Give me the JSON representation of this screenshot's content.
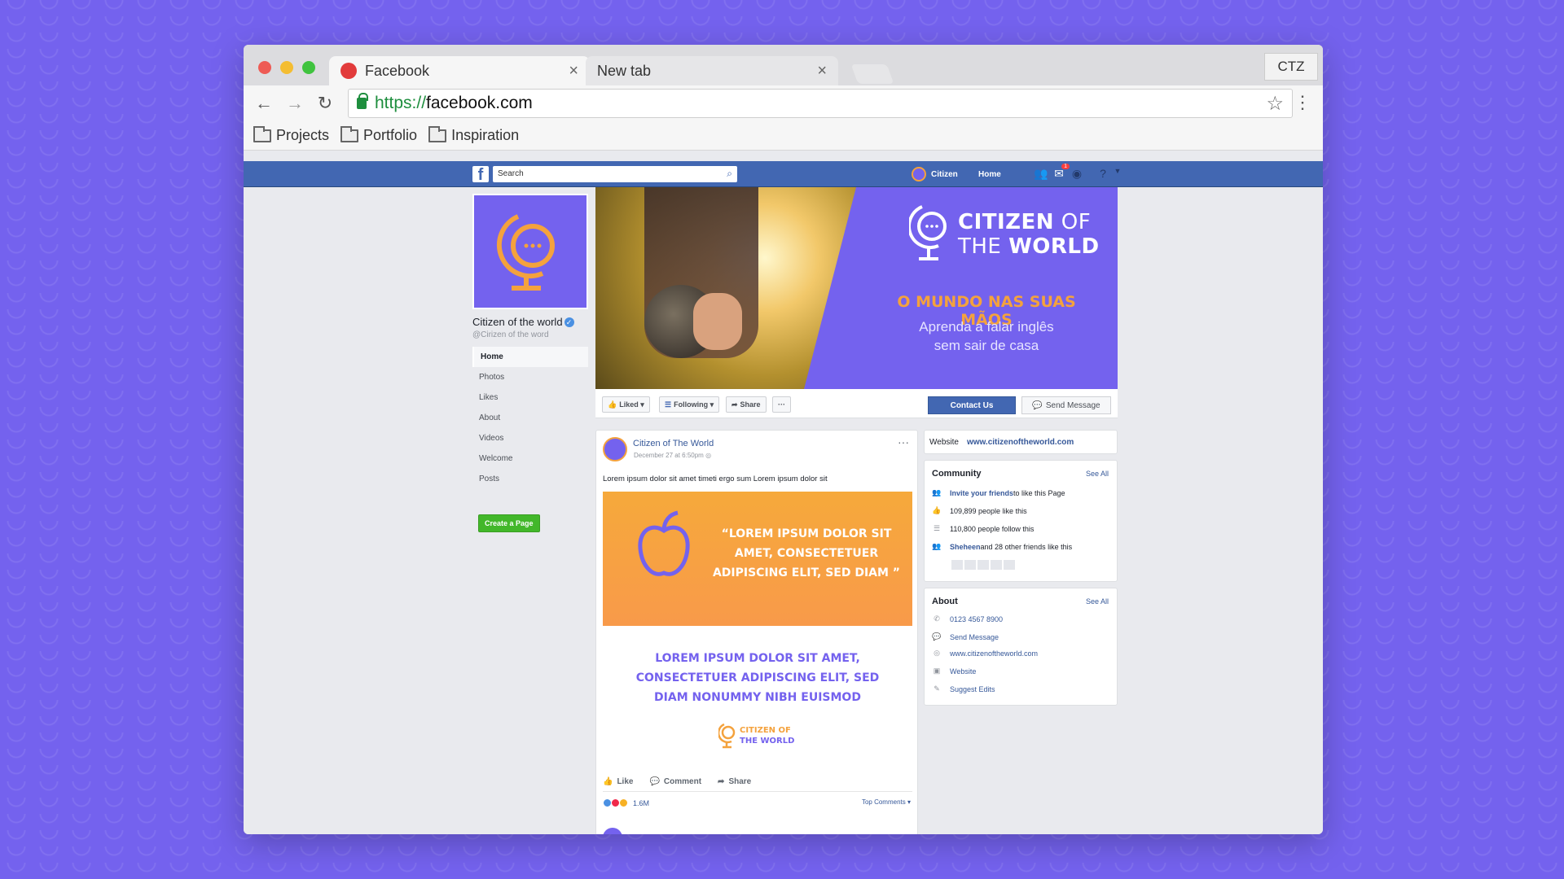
{
  "browser": {
    "tabs": [
      {
        "title": "Facebook",
        "close": "×"
      },
      {
        "title": "New tab",
        "close": "×"
      }
    ],
    "profile": "CTZ",
    "url_proto": "https://",
    "url_host": "facebook.com",
    "bookmarks": [
      "Projects",
      "Portfolio",
      "Inspiration"
    ]
  },
  "fb": {
    "search_placeholder": "Search",
    "nav_user": "Citizen",
    "nav_home": "Home",
    "notification_count": "1",
    "page_name": "Citizen of the world",
    "page_handle": "@Cirizen of the word",
    "left_nav": [
      "Home",
      "Photos",
      "Likes",
      "About",
      "Videos",
      "Welcome",
      "Posts"
    ],
    "create_page": "Create a Page",
    "cover": {
      "brand_line1_bold": "CITIZEN",
      "brand_line1_thin": " OF",
      "brand_line2_thin": "THE ",
      "brand_line2_bold": "WORLD",
      "tagline": "O MUNDO NAS SUAS MÃOS",
      "sub_line1": "Aprenda a falar inglês",
      "sub_line2": "sem sair de casa"
    },
    "actions": {
      "liked": "Liked ▾",
      "following": "Following ▾",
      "share": "Share",
      "more": "···",
      "contact": "Contact Us",
      "send_message": "Send Message"
    },
    "post": {
      "author": "Citizen of The World",
      "date": "December 27 at 6:50pm",
      "text": "Lorem ipsum dolor sit amet timeti ergo sum Lorem ipsum dolor sit",
      "image_quote": "“LOREM IPSUM DOLOR SIT AMET, CONSECTETUER ADIPISCING ELIT, SED DIAM ”",
      "headline": "LOREM IPSUM DOLOR SIT AMET, CONSECTETUER ADIPISCING ELIT, SED DIAM NONUMMY NIBH EUISMOD",
      "logo_line1": "CITIZEN",
      "logo_line1_thin": " OF",
      "logo_line2_thin": "THE ",
      "logo_line2": "WORLD",
      "like": "Like",
      "comment": "Comment",
      "share": "Share",
      "reactions": "1.6M",
      "top_comments": "Top Comments ▾"
    },
    "website": {
      "label": "Website",
      "url": "www.citizenoftheworld.com"
    },
    "community": {
      "title": "Community",
      "see_all": "See All",
      "invite_link": "Invite your friends",
      "invite_rest": " to like this Page",
      "likes": "109,899 people like this",
      "follows": "110,800 people follow this",
      "friend_name": "Sheheen",
      "friends_rest": " and 28 other friends like this"
    },
    "about": {
      "title": "About",
      "see_all": "See All",
      "phone": "0123 4567 8900",
      "send_message": "Send Message",
      "website_url": "www.citizenoftheworld.com",
      "website": "Website",
      "suggest": "Suggest Edits"
    }
  },
  "colors": {
    "background": "#7462ee",
    "facebook_blue": "#4267b2",
    "accent_orange": "#f4a23d"
  }
}
